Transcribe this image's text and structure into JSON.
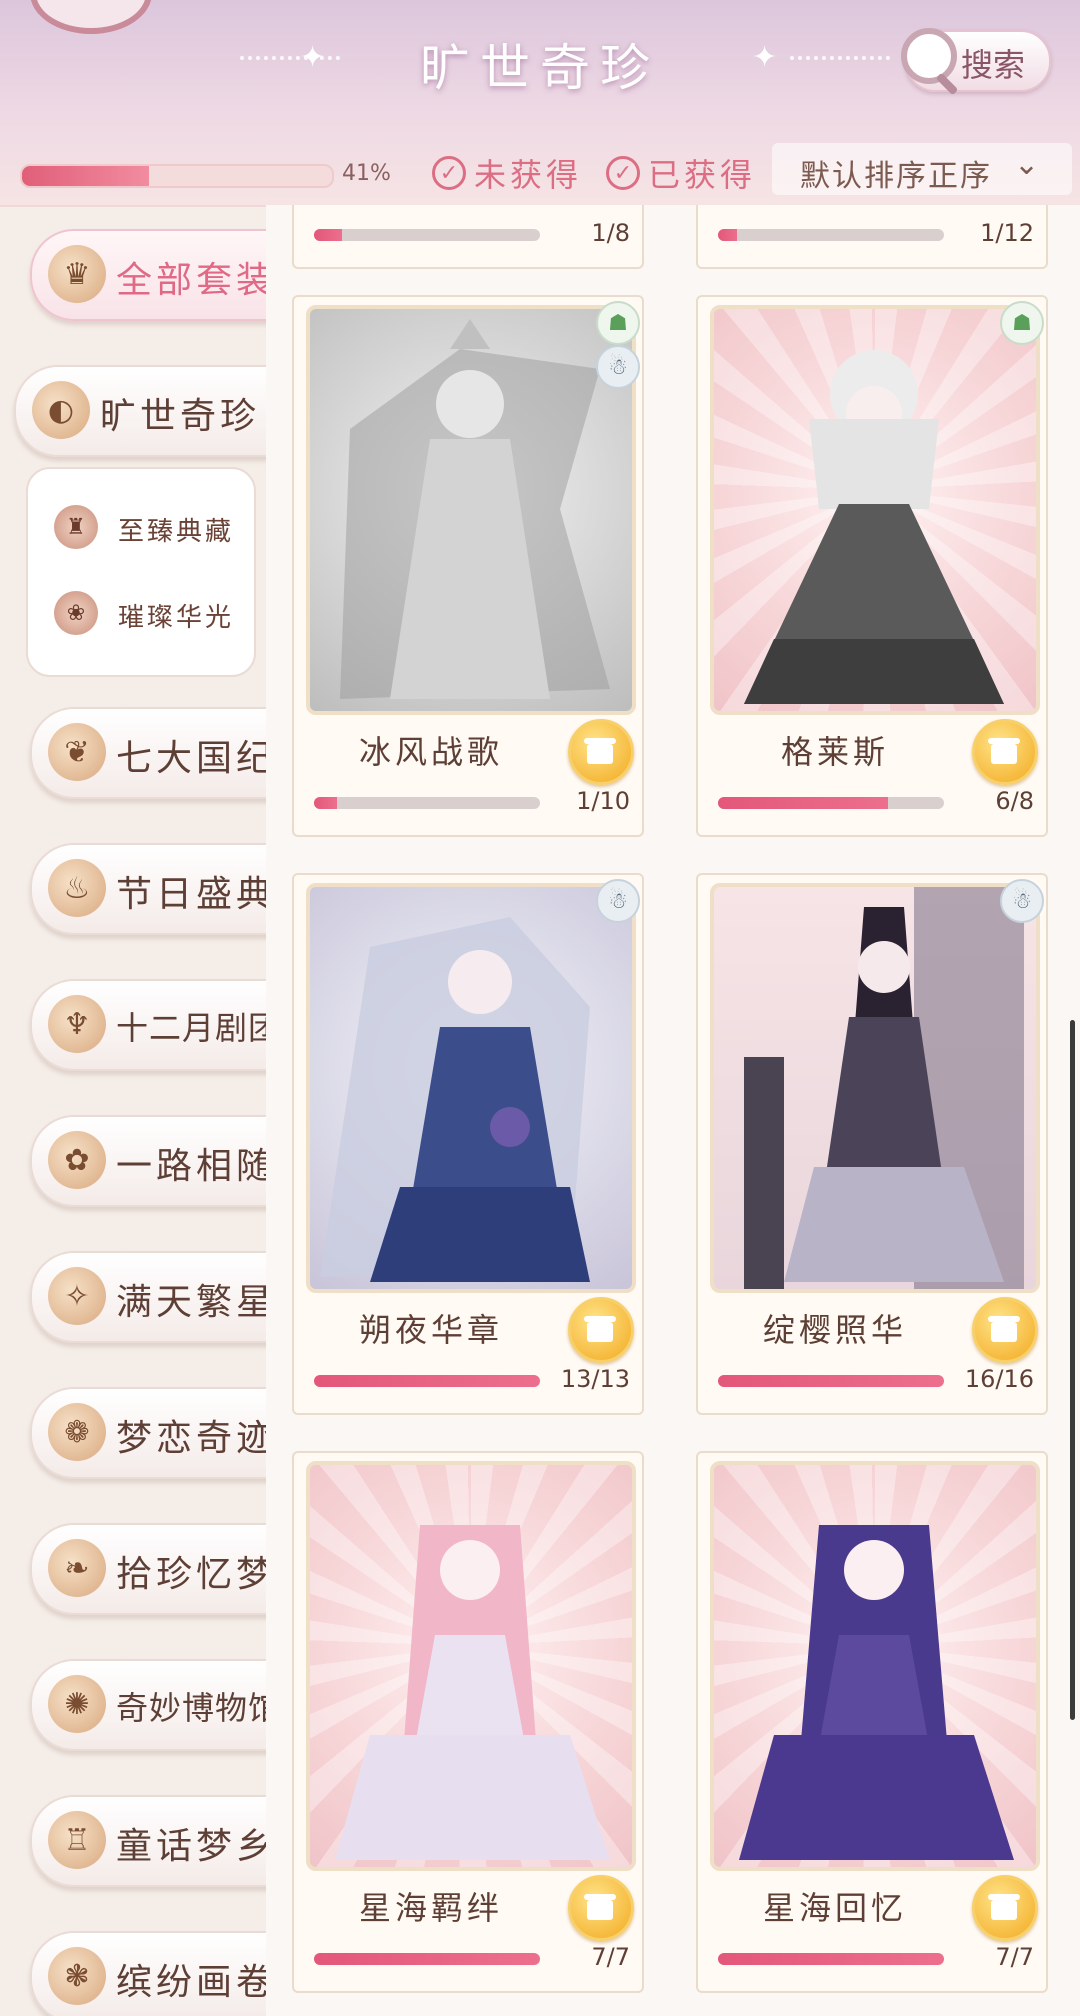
{
  "header": {
    "title": "旷世奇珍",
    "search_label": "搜索",
    "progress_percent": 41,
    "progress_text": "41%",
    "filter_unowned": "未获得",
    "filter_owned": "已获得",
    "sort_label": "默认排序正序"
  },
  "sidebar": {
    "items": [
      {
        "label": "全部套装",
        "icon": "dress-icon"
      },
      {
        "label": "旷世奇珍",
        "icon": "shell-icon"
      },
      {
        "label": "七大国纪",
        "icon": "map-icon"
      },
      {
        "label": "节日盛典",
        "icon": "lantern-icon"
      },
      {
        "label": "十二月剧团",
        "icon": "chandelier-icon"
      },
      {
        "label": "一路相随",
        "icon": "flower-icon"
      },
      {
        "label": "满天繁星",
        "icon": "constellation-icon"
      },
      {
        "label": "梦恋奇迹",
        "icon": "rose-icon"
      },
      {
        "label": "拾珍忆梦",
        "icon": "branch-icon"
      },
      {
        "label": "奇妙博物馆",
        "icon": "compass-icon"
      },
      {
        "label": "童话梦乡",
        "icon": "castle-icon"
      },
      {
        "label": "缤纷画卷",
        "icon": "butterfly-icon"
      }
    ],
    "sub_items": [
      {
        "label": "至臻典藏",
        "icon": "treasure-icon"
      },
      {
        "label": "璀璨华光",
        "icon": "brooch-icon"
      }
    ]
  },
  "top_partial": [
    {
      "count": "1/8",
      "progress": 0.125
    },
    {
      "count": "1/12",
      "progress": 0.083
    }
  ],
  "cards": [
    {
      "name": "冰风战歌",
      "count": "1/10",
      "progress": 0.1
    },
    {
      "name": "格莱斯",
      "count": "6/8",
      "progress": 0.75
    },
    {
      "name": "朔夜华章",
      "count": "13/13",
      "progress": 1.0
    },
    {
      "name": "绽樱照华",
      "count": "16/16",
      "progress": 1.0
    },
    {
      "name": "星海羁绊",
      "count": "7/7",
      "progress": 1.0
    },
    {
      "name": "星海回忆",
      "count": "7/7",
      "progress": 1.0
    }
  ],
  "colors": {
    "accent": "#e06a86",
    "progress": "#e3577a",
    "gift": "#f2a91f"
  }
}
